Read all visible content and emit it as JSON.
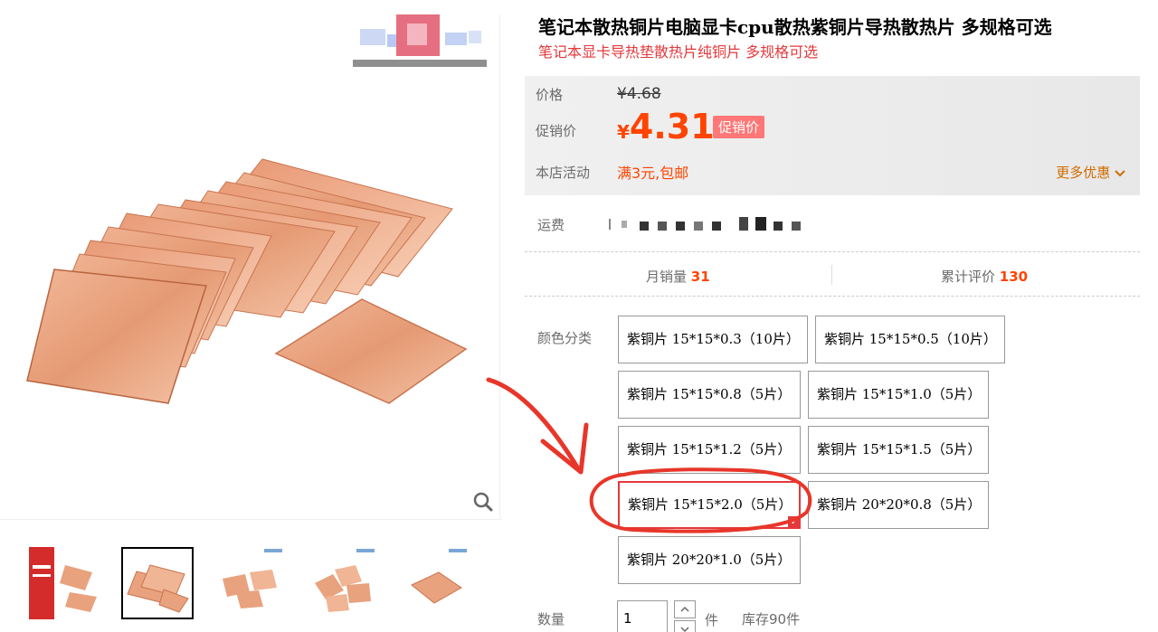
{
  "product": {
    "title": "笔记本散热铜片电脑显卡cpu散热紫铜片导热散热片 多规格可选",
    "subtitle": "笔记本显卡导热垫散热片纯铜片 多规格可选"
  },
  "price": {
    "label": "价格",
    "original": "¥4.68",
    "promo_label": "促销价",
    "promo_currency": "¥",
    "promo_value": "4.31",
    "promo_badge": "促销价",
    "activity_label": "本店活动",
    "activity_value": "满3元,包邮",
    "more_discount": "更多优惠"
  },
  "shipping": {
    "label": "运费"
  },
  "stats": {
    "monthly_sales_label": "月销量",
    "monthly_sales_value": "31",
    "reviews_label": "累计评价",
    "reviews_value": "130"
  },
  "sku": {
    "label": "颜色分类",
    "options": [
      "紫铜片 15*15*0.3（10片）",
      "紫铜片 15*15*0.5（10片）",
      "紫铜片 15*15*0.8（5片）",
      "紫铜片 15*15*1.0（5片）",
      "紫铜片 15*15*1.2（5片）",
      "紫铜片 15*15*1.5（5片）",
      "紫铜片 15*15*2.0（5片）",
      "紫铜片 20*20*0.8（5片）",
      "紫铜片 20*20*1.0（5片）"
    ],
    "selected_option": "紫铜片 15*15*2.0（5片）"
  },
  "quantity": {
    "label": "数量",
    "value": "1",
    "unit": "件",
    "stock": "库存90件"
  },
  "colors": {
    "accent": "#e4393c",
    "price": "#ff4400",
    "copper": "#e8a27e",
    "annotation": "#e8362a"
  },
  "icons": [
    "zoom-icon",
    "chevron-down-icon",
    "checkmark-icon",
    "arrow-up-icon",
    "arrow-down-icon"
  ]
}
